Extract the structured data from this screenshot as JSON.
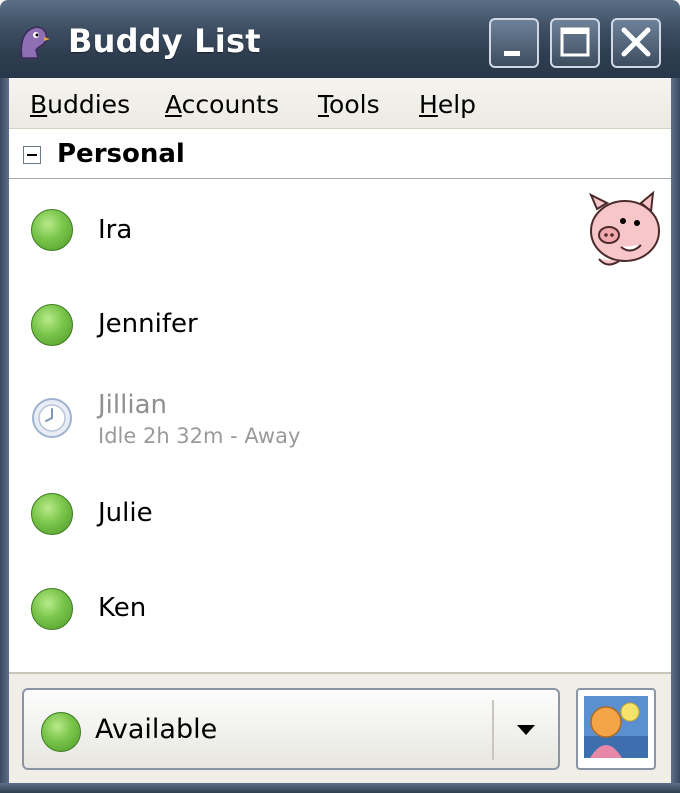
{
  "window": {
    "title": "Buddy List",
    "app_icon": "pidgin-purple-bird-icon"
  },
  "titlebar_buttons": [
    "minimize-icon",
    "maximize-icon",
    "close-icon"
  ],
  "menu": [
    {
      "label": "Buddies",
      "mnemonic": "B"
    },
    {
      "label": "Accounts",
      "mnemonic": "A"
    },
    {
      "label": "Tools",
      "mnemonic": "T"
    },
    {
      "label": "Help",
      "mnemonic": "H"
    }
  ],
  "group": {
    "label": "Personal",
    "expanded": true
  },
  "buddies": [
    {
      "name": "Ira",
      "status": "available",
      "status_text": "",
      "icon": "pig-buddy-icon"
    },
    {
      "name": "Jennifer",
      "status": "available",
      "status_text": ""
    },
    {
      "name": "Jillian",
      "status": "idle-away",
      "status_text": "Idle 2h 32m - Away"
    },
    {
      "name": "Julie",
      "status": "available",
      "status_text": ""
    },
    {
      "name": "Ken",
      "status": "available",
      "status_text": ""
    }
  ],
  "status_selector": {
    "label": "Available",
    "icon": "available-green-dot-icon"
  },
  "account_icon": "account-buddy-icon",
  "colors": {
    "available": "#79c44a",
    "away_text": "#8f8f8f",
    "titlebar": "#3f5064"
  }
}
